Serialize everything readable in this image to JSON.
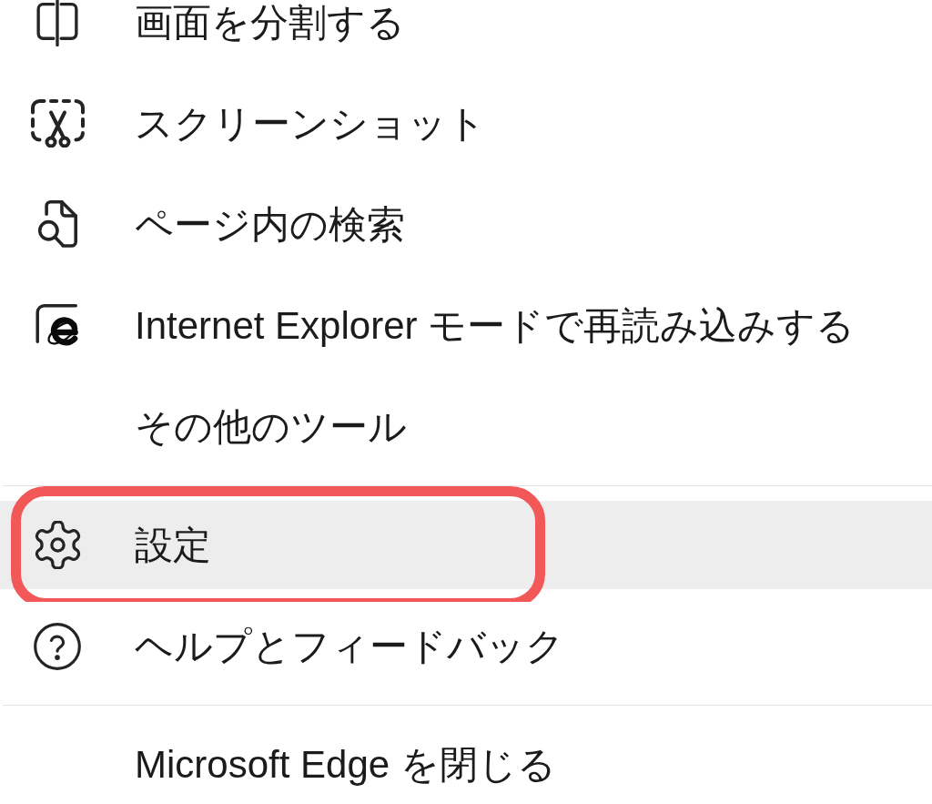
{
  "menu": {
    "sections": [
      {
        "items": [
          {
            "label": "画面を分割する",
            "kind": "split",
            "selected": false,
            "outlined": false
          },
          {
            "label": "スクリーンショット",
            "kind": "screenshot",
            "selected": false,
            "outlined": false
          },
          {
            "label": "ページ内の検索",
            "kind": "find",
            "selected": false,
            "outlined": false
          },
          {
            "label": "Internet Explorer モードで再読み込みする",
            "kind": "ie",
            "selected": false,
            "outlined": false
          },
          {
            "label": "その他のツール",
            "kind": "plain",
            "selected": false,
            "outlined": false
          }
        ]
      },
      {
        "items": [
          {
            "label": "設定",
            "kind": "settings",
            "selected": true,
            "outlined": true
          },
          {
            "label": "ヘルプとフィードバック",
            "kind": "help",
            "selected": false,
            "outlined": false
          }
        ]
      },
      {
        "items": [
          {
            "label": "Microsoft Edge を閉じる",
            "kind": "plain",
            "selected": false,
            "outlined": false
          }
        ]
      }
    ]
  }
}
